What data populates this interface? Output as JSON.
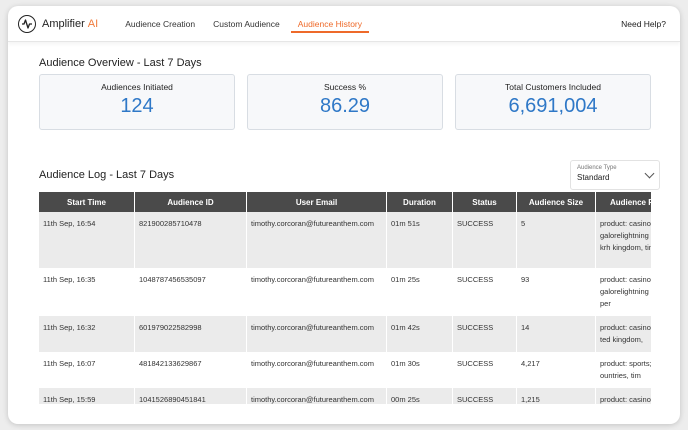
{
  "app": {
    "name": "Amplifier",
    "name_accent": "AI"
  },
  "nav": {
    "tabs": [
      {
        "label": "Audience Creation"
      },
      {
        "label": "Custom Audience"
      },
      {
        "label": "Audience History",
        "active": true
      }
    ],
    "help_label": "Need Help?"
  },
  "overview": {
    "title": "Audience Overview - Last 7 Days",
    "cards": [
      {
        "label": "Audiences Initiated",
        "value": "124"
      },
      {
        "label": "Success %",
        "value": "86.29"
      },
      {
        "label": "Total Customers Included",
        "value": "6,691,004"
      }
    ]
  },
  "log": {
    "title": "Audience Log - Last 7 Days",
    "filter": {
      "label": "Audience Type",
      "value": "Standard"
    },
    "columns": [
      "Start Time",
      "Audience ID",
      "User Email",
      "Duration",
      "Status",
      "Audience Size",
      "Audience P"
    ],
    "rows": [
      [
        "11th Sep, 16:54",
        "821900285710478",
        "timothy.corcoran@futureanthem.com",
        "01m 51s",
        "SUCCESS",
        "5",
        "product: casino; recent_g mgs_ballsgalorelightning rickandmortystrikebackrh kingdom, time period: tod"
      ],
      [
        "11th Sep, 16:35",
        "1048787456535097",
        "timothy.corcoran@futureanthem.com",
        "01m 25s",
        "SUCCESS",
        "93",
        "product: casino; recent_g mgs_ballsgalorelightning united kingdom, time per"
      ],
      [
        "11th Sep, 16:32",
        "601979022582998",
        "timothy.corcoran@futureanthem.com",
        "01m 42s",
        "SUCCESS",
        "14",
        "product: casino; recent_g country united kingdom,"
      ],
      [
        "11th Sep, 16:07",
        "481842133629867",
        "timothy.corcoran@futureanthem.com",
        "01m 30s",
        "SUCCESS",
        "4,217",
        "product: sports; winners: country all countries, tim"
      ],
      [
        "11th Sep, 15:59",
        "1041526890451841",
        "timothy.corcoran@futureanthem.com",
        "00m 25s",
        "SUCCESS",
        "1,215",
        "product: casino; most_pl rickandmortystrikebackrh"
      ]
    ]
  },
  "colors": {
    "accent": "#ee6a2a",
    "value_blue": "#2f78c7",
    "header_bg": "#4a4a4a"
  },
  "icons": {
    "logo": "amplifier-logo-icon",
    "dropdown": "chevron-down-icon"
  }
}
